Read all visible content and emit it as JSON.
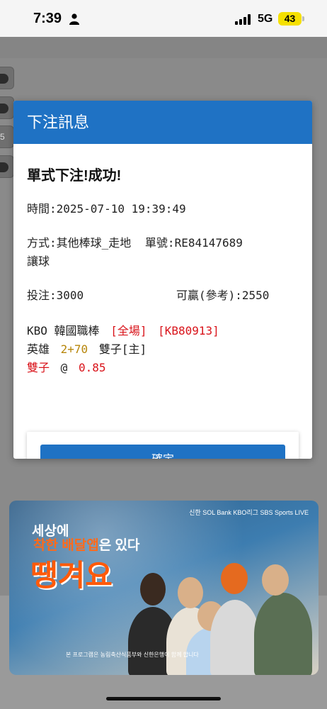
{
  "status_bar": {
    "time": "7:39",
    "person_icon": "person-fill-icon",
    "signal_icon": "cellular-signal-icon",
    "network": "5G",
    "battery": "43",
    "battery_color": "#f5e000"
  },
  "background": {
    "side_label": "5"
  },
  "dialog": {
    "title": "下注訊息",
    "header_color": "#1f72c4",
    "result": "單式下注!成功!",
    "time_label": "時間:",
    "time_value": "2025-07-10 19:39:49",
    "method_label": "方式:",
    "method_value": "其他棒球_走地",
    "ticket_label": "單號:",
    "ticket_value": "RE84147689",
    "bet_type": "讓球",
    "stake_label": "投注:",
    "stake_value": "3000",
    "win_label": "可贏(參考):",
    "win_value": "2550",
    "league": "KBO 韓國職棒",
    "scope": "[全場]",
    "match_id": "[KB80913]",
    "home_team": "英雄",
    "handicap": "2+70",
    "away_team": "雙子[主]",
    "pick": "雙子",
    "at": "@",
    "odds": "0.85",
    "confirm_label": "確定",
    "accent_red": "#d9141b",
    "accent_gold": "#b7860b"
  },
  "ad": {
    "top_right": "신한 SOL Bank KBO리그  SBS Sports LIVE",
    "line1": "세상에",
    "line2_highlight": "착한 배달앱",
    "line2_rest": "은 있다",
    "headline": "땡겨요",
    "footer": "본 프로그램은 농림축산식품부와 신한은행이 함께 합니다"
  }
}
